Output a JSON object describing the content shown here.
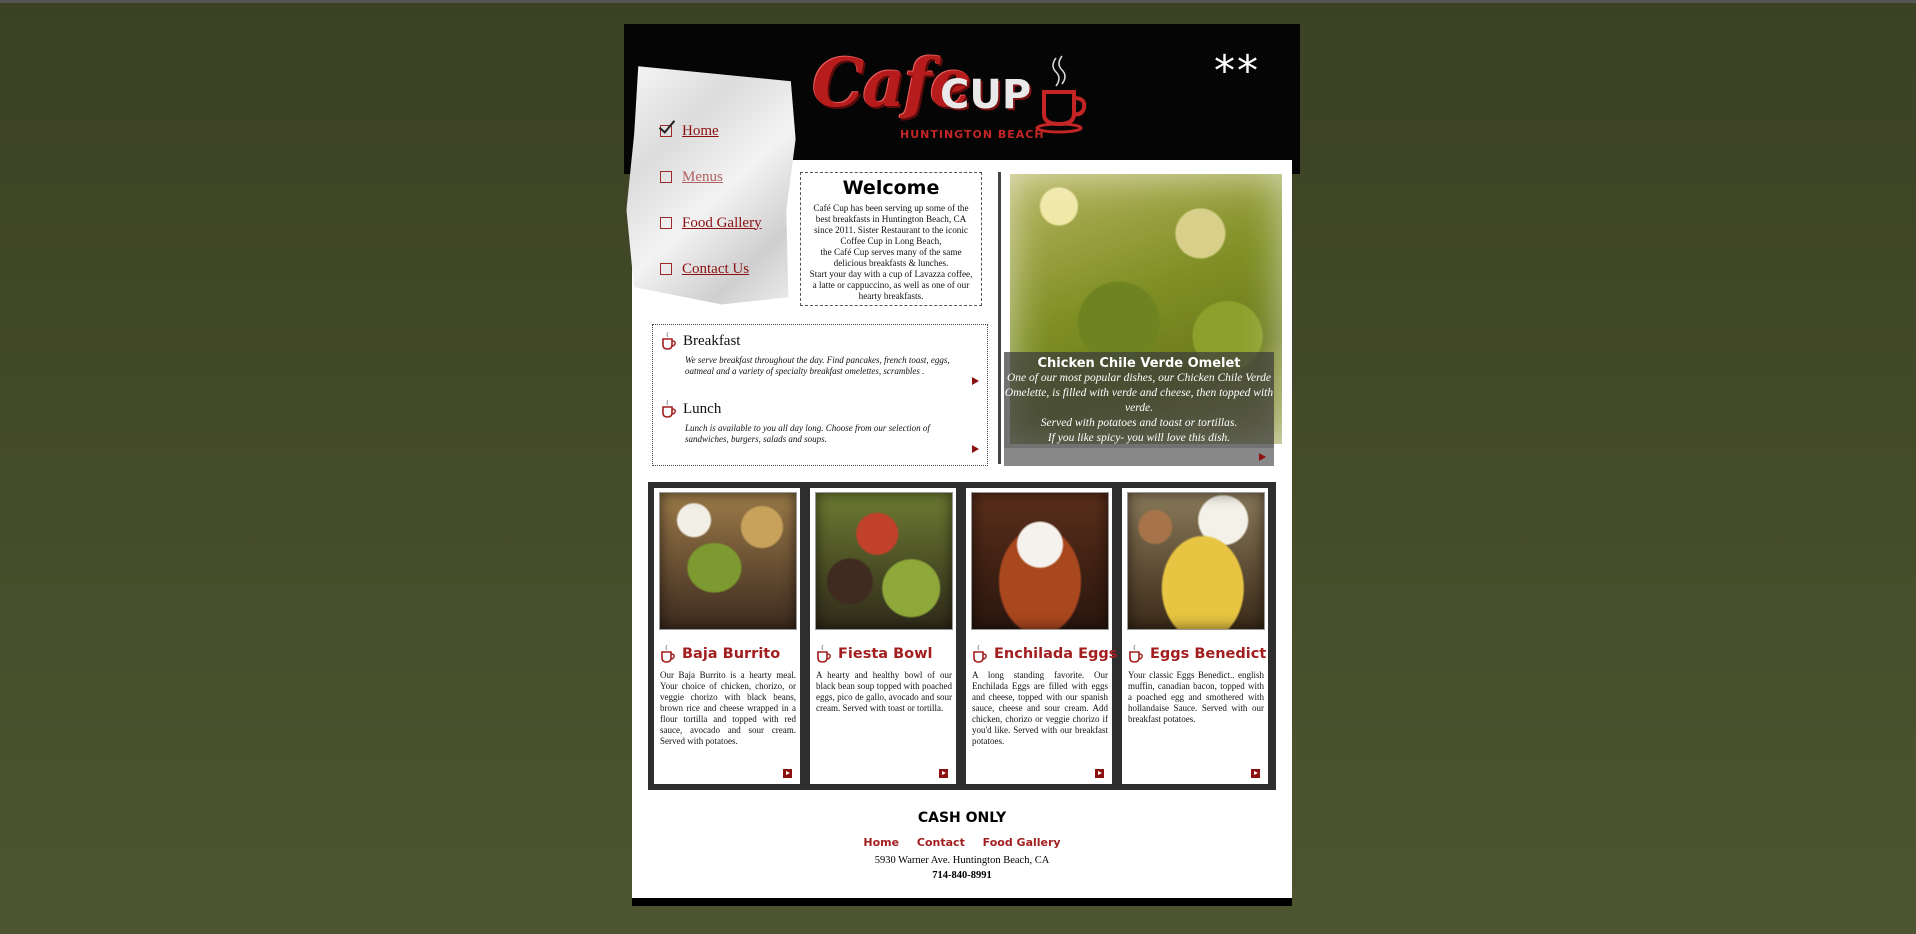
{
  "brand": {
    "logo_script": "Cafe",
    "logo_word": "CUP",
    "logo_sub": "HUNTINGTON BEACH",
    "decoration": "**"
  },
  "nav": {
    "items": [
      {
        "label": "Home"
      },
      {
        "label": "Menus"
      },
      {
        "label": "Food Gallery"
      },
      {
        "label": "Contact Us"
      }
    ]
  },
  "welcome": {
    "title": "Welcome",
    "text": "Café Cup has been serving up some of the best breakfasts in Huntington Beach, CA since 2011. Sister Restaurant to the iconic Coffee Cup in Long Beach,\nthe Café Cup serves many of the same delicious breakfasts & lunches.\nStart your day with a cup of Lavazza coffee, a latte or cappuccino, as well as one of our hearty breakfasts."
  },
  "feature": {
    "title": "Chicken Chile Verde Omelet",
    "text": "One of our most popular dishes, our Chicken Chile Verde Omelette, is filled with verde and cheese, then topped with verde.\nServed with potatoes and toast or tortillas.\nIf you like spicy- you will love this dish."
  },
  "meals": [
    {
      "title": "Breakfast",
      "desc": "We serve breakfast throughout the day. Find pancakes, french toast, eggs, oatmeal and a variety of specialty breakfast omelettes, scrambles ."
    },
    {
      "title": "Lunch",
      "desc": "Lunch is available to you all day long.  Choose from our selection of sandwiches, burgers, salads and soups."
    }
  ],
  "cards": [
    {
      "title": "Baja Burrito",
      "desc": "Our Baja Burrito is a hearty meal.  Your choice of chicken, chorizo, or veggie chorizo with black beans, brown rice and cheese wrapped in a flour tortilla and topped with red sauce, avocado and sour cream.  Served with potatoes."
    },
    {
      "title": "Fiesta Bowl",
      "desc": "A hearty and healthy bowl of our black bean soup topped with poached eggs, pico de gallo, avocado and sour cream.  Served with toast or tortilla."
    },
    {
      "title": "Enchilada Eggs",
      "desc": "A long standing favorite.  Our Enchilada Eggs are filled with eggs and cheese, topped with our spanish sauce, cheese and sour cream. Add chicken, chorizo or veggie chorizo if you'd like.  Served with our breakfast potatoes."
    },
    {
      "title": "Eggs Benedict",
      "desc": "Your classic Eggs Benedict.. english muffin, canadian bacon, topped with a poached egg and smothered with hollandaise Sauce.  Served with our breakfast potatoes."
    }
  ],
  "footer": {
    "cash": "CASH ONLY",
    "links": [
      "Home",
      "Contact",
      "Food Gallery"
    ],
    "address": "5930 Warner Ave.  Huntington Beach, CA",
    "phone": "714-840-8991"
  },
  "colors": {
    "accent": "#a31f1f",
    "background": "#434a28",
    "header": "#050505"
  }
}
